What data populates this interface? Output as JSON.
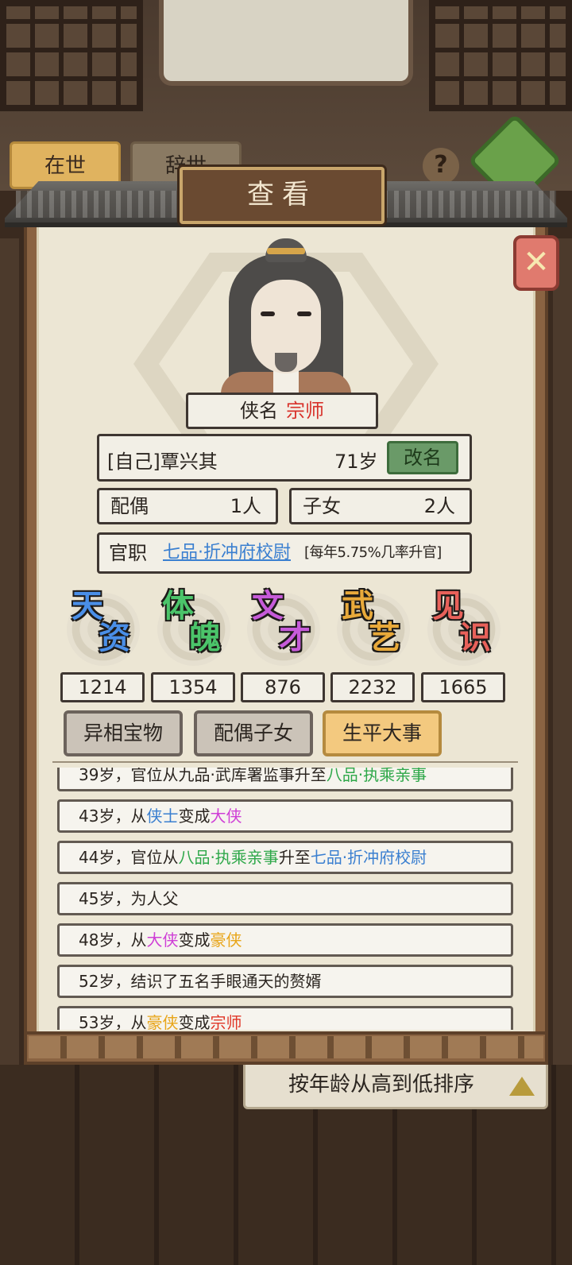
{
  "background": {
    "tab_alive": "在世",
    "tab_dead": "辞世",
    "help_icon": "?",
    "sort_label": "按年龄从高到低排序"
  },
  "dialog": {
    "title": "查看",
    "close_icon": "✕"
  },
  "character": {
    "title_label": "侠名",
    "title_value": "宗师",
    "name": "[自己]覃兴其",
    "age": "71岁",
    "rename_label": "改名",
    "spouse_label": "配偶",
    "spouse_value": "1人",
    "children_label": "子女",
    "children_value": "2人",
    "official_label": "官职",
    "official_rank": "七品·折冲府校尉",
    "promotion_chance": "[每年5.75%几率升官]"
  },
  "attributes": [
    {
      "name": "天资",
      "value": "1214",
      "color": "#4a8fe8"
    },
    {
      "name": "体魄",
      "value": "1354",
      "color": "#4bc46a"
    },
    {
      "name": "文才",
      "value": "876",
      "color": "#c65bd9"
    },
    {
      "name": "武艺",
      "value": "2232",
      "color": "#e8a93a"
    },
    {
      "name": "见识",
      "value": "1665",
      "color": "#e8615a"
    }
  ],
  "tabs": {
    "treasure": "异相宝物",
    "family": "配偶子女",
    "events": "生平大事",
    "active": "events"
  },
  "events": [
    {
      "parts": [
        {
          "t": "39岁，官位从九品·武库署监事升至"
        },
        {
          "t": "八品·执乘亲事",
          "c": "green"
        }
      ]
    },
    {
      "parts": [
        {
          "t": "43岁，从"
        },
        {
          "t": "侠士",
          "c": "blue"
        },
        {
          "t": "变成"
        },
        {
          "t": "大侠",
          "c": "purple"
        }
      ]
    },
    {
      "parts": [
        {
          "t": "44岁，官位从"
        },
        {
          "t": "八品·执乘亲事",
          "c": "green"
        },
        {
          "t": "升至"
        },
        {
          "t": "七品·折冲府校尉",
          "c": "blue"
        }
      ]
    },
    {
      "parts": [
        {
          "t": "45岁，为人父"
        }
      ]
    },
    {
      "parts": [
        {
          "t": "48岁，从"
        },
        {
          "t": "大侠",
          "c": "purple"
        },
        {
          "t": "变成"
        },
        {
          "t": "豪侠",
          "c": "orange"
        }
      ]
    },
    {
      "parts": [
        {
          "t": "52岁，结识了五名手眼通天的赘婿"
        }
      ]
    },
    {
      "parts": [
        {
          "t": "53岁，从"
        },
        {
          "t": "豪侠",
          "c": "orange"
        },
        {
          "t": "变成"
        },
        {
          "t": "宗师",
          "c": "red"
        }
      ]
    }
  ]
}
